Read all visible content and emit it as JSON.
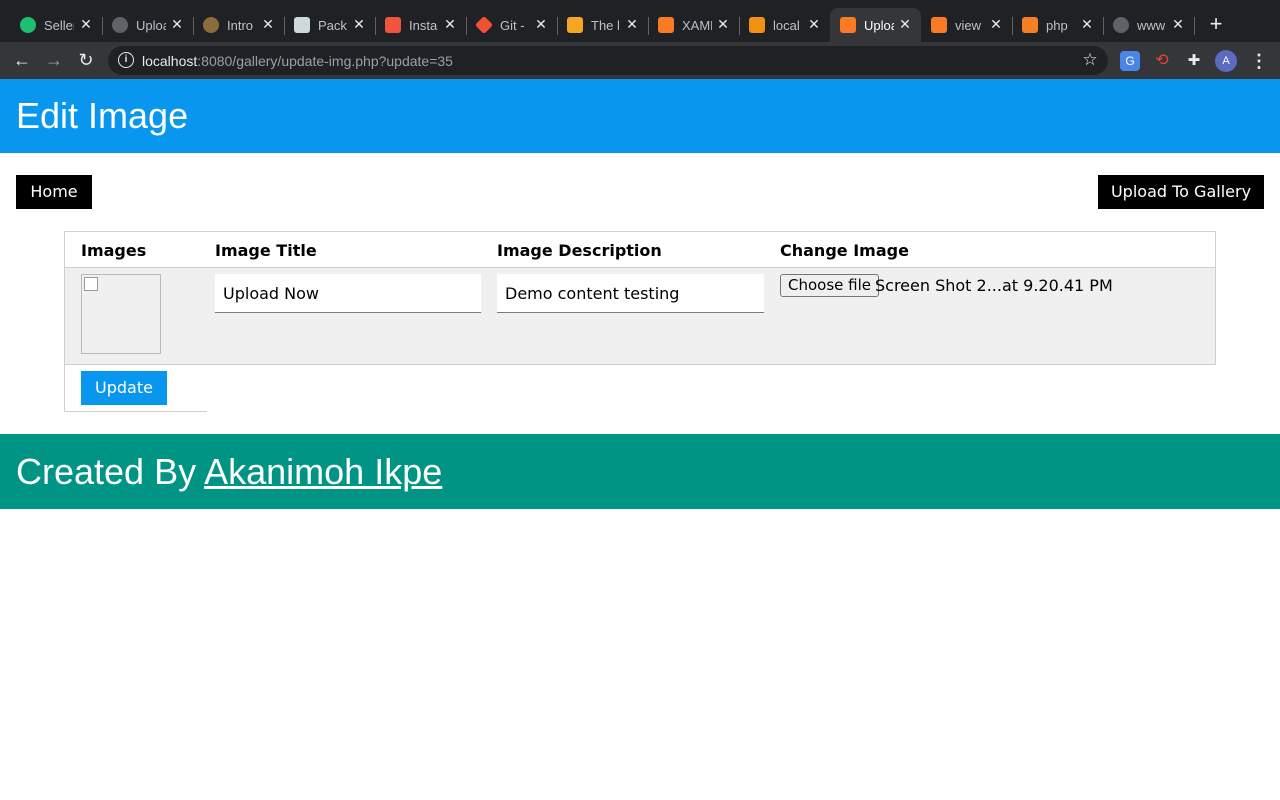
{
  "browser": {
    "tabs": [
      {
        "title": "Seller",
        "favicon_color": "#1dbf73",
        "icon": "fiverr-icon"
      },
      {
        "title": "Uploa",
        "favicon_color": "#5f6368",
        "icon": "globe-icon"
      },
      {
        "title": "Intro",
        "favicon_color": "#8a6d3b",
        "icon": "avatar-icon"
      },
      {
        "title": "Pack",
        "favicon_color": "#cfd8dc",
        "icon": "package-icon"
      },
      {
        "title": "Insta",
        "favicon_color": "#f05340",
        "icon": "laravel-icon"
      },
      {
        "title": "Git -",
        "favicon_color": "#f05033",
        "icon": "git-icon"
      },
      {
        "title": "The l",
        "favicon_color": "#f6a623",
        "icon": "beer-icon"
      },
      {
        "title": "XAMPP",
        "favicon_color": "#fb7a24",
        "icon": "xampp-icon"
      },
      {
        "title": "local",
        "favicon_color": "#f29111",
        "icon": "phpmyadmin-icon"
      },
      {
        "title": "Uploa",
        "favicon_color": "#fb7a24",
        "icon": "xampp-icon",
        "active": true
      },
      {
        "title": "view",
        "favicon_color": "#fb7a24",
        "icon": "xampp-icon"
      },
      {
        "title": "php",
        "favicon_color": "#f48024",
        "icon": "stackoverflow-icon"
      },
      {
        "title": "www",
        "favicon_color": "#5f6368",
        "icon": "globe-icon"
      }
    ],
    "url_host": "localhost",
    "url_rest": ":8080/gallery/update-img.php?update=35",
    "profile_initial": "A"
  },
  "page": {
    "title": "Edit Image",
    "home_label": "Home",
    "upload_label": "Upload To Gallery"
  },
  "table": {
    "headers": [
      "Images",
      "Image Title",
      "Image Description",
      "Change Image"
    ],
    "row": {
      "title_value": "Upload Now",
      "description_value": "Demo content testing",
      "choose_file_label": "Choose file",
      "file_name": "Screen Shot 2...at 9.20.41 PM"
    },
    "update_label": "Update"
  },
  "footer": {
    "prefix": "Created By ",
    "author": "Akanimoh Ikpe"
  },
  "colors": {
    "header_bg": "#0996ee",
    "footer_bg": "#009485",
    "button_black": "#000000",
    "update_button": "#0996ee"
  }
}
